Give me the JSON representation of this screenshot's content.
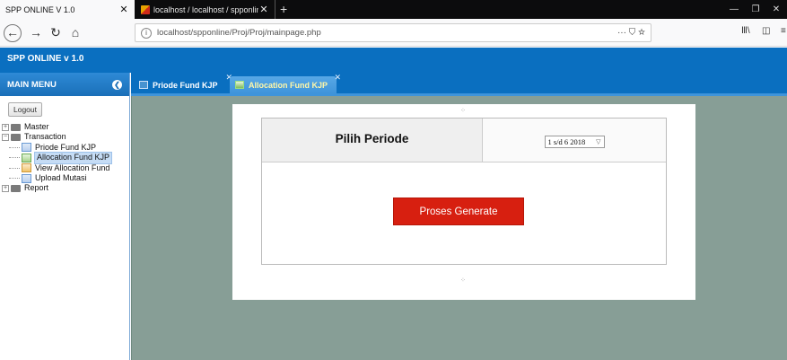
{
  "browser": {
    "tabs": [
      {
        "title": "SPP ONLINE V 1.0",
        "active": true
      },
      {
        "title": "localhost / localhost / spponlin",
        "active": false
      }
    ],
    "url": "localhost/spponline/Proj/Proj/mainpage.php",
    "url_actions": "··· ⛉ ☆"
  },
  "app": {
    "title": "SPP ONLINE v 1.0"
  },
  "sidebar": {
    "header": "MAIN MENU",
    "logout_label": "Logout",
    "tree": {
      "master": "Master",
      "transaction": "Transaction",
      "children": [
        "Priode Fund KJP",
        "Allocation Fund KJP",
        "View Allocation Fund",
        "Upload Mutasi"
      ],
      "report": "Report"
    }
  },
  "content_tabs": [
    {
      "label": "Priode Fund KJP"
    },
    {
      "label": "Allocation Fund KJP",
      "active": true
    }
  ],
  "form": {
    "periode_label": "Pilih Periode",
    "periode_selected": "1 s/d 6 2018",
    "generate_label": "Proses Generate"
  },
  "colors": {
    "header_blue": "#0a6fc0",
    "content_bg": "#879e96",
    "button_red": "#d71f10"
  }
}
